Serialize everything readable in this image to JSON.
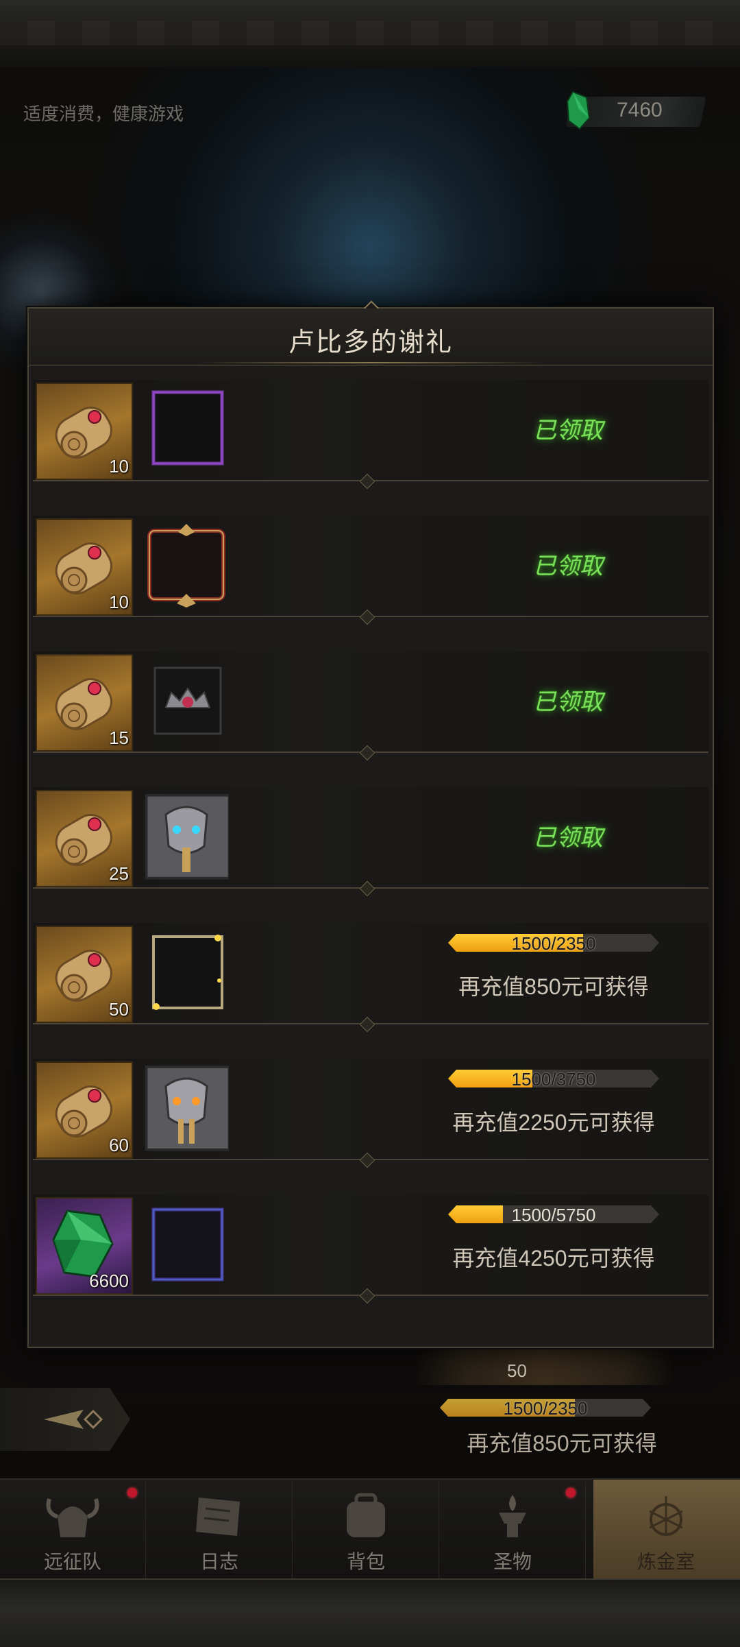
{
  "header": {
    "health_tip": "适度消费，健康游戏",
    "gem_count": "7460",
    "gem_icon": "emerald-gem-icon"
  },
  "modal": {
    "title": "卢比多的谢礼",
    "rows": [
      {
        "reward_count": "10",
        "reward_icon": "scroll-icon",
        "frame_icon": "purple-frame-icon",
        "status": "已领取"
      },
      {
        "reward_count": "10",
        "reward_icon": "scroll-icon",
        "frame_icon": "ornate-red-frame-icon",
        "status": "已领取"
      },
      {
        "reward_count": "15",
        "reward_icon": "scroll-icon",
        "frame_icon": "crown-emblem-icon",
        "status": "已领取"
      },
      {
        "reward_count": "25",
        "reward_icon": "scroll-icon",
        "frame_icon": "knight-helmet-one-icon",
        "status": "已领取"
      },
      {
        "reward_count": "50",
        "reward_icon": "scroll-icon",
        "frame_icon": "gold-frame-icon",
        "progress_text": "1500/2350",
        "progress": 0.64,
        "recharge": "再充值850元可获得"
      },
      {
        "reward_count": "60",
        "reward_icon": "scroll-icon",
        "frame_icon": "knight-helmet-two-icon",
        "progress_text": "1500/3750",
        "progress": 0.4,
        "recharge": "再充值2250元可获得"
      },
      {
        "reward_count": "6600",
        "reward_icon": "emerald-gem-icon",
        "frame_icon": "blue-frame-icon",
        "progress_text": "1500/5750",
        "progress": 0.26,
        "recharge": "再充值4250元可获得"
      }
    ]
  },
  "behind": {
    "count": "50",
    "progress_text": "1500/2350",
    "progress": 0.64,
    "recharge": "再充值850元可获得"
  },
  "nav": {
    "items": [
      {
        "label": "远征队",
        "icon": "viking-helmet-icon",
        "badge": true
      },
      {
        "label": "日志",
        "icon": "journal-icon",
        "badge": false
      },
      {
        "label": "背包",
        "icon": "backpack-icon",
        "badge": false
      },
      {
        "label": "圣物",
        "icon": "relic-icon",
        "badge": true
      },
      {
        "label": "炼金室",
        "icon": "alchemy-icon",
        "badge": false,
        "active": true
      }
    ]
  },
  "colors": {
    "claimed": "#7be05a",
    "progress_fill": "#f0a010",
    "badge": "#c0182a"
  }
}
